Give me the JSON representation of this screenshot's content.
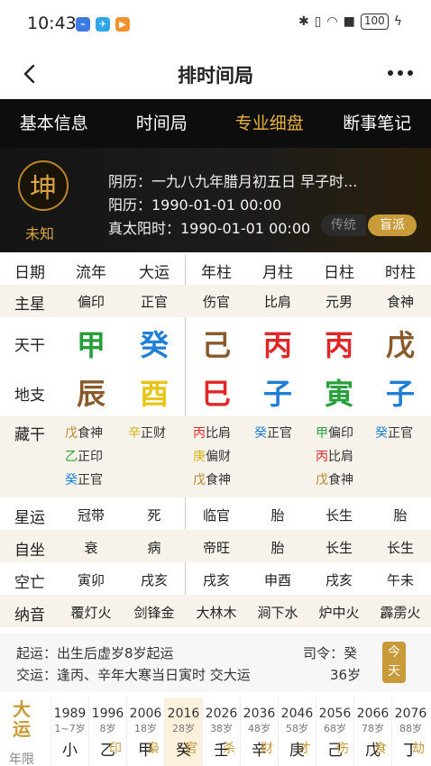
{
  "status": {
    "time": "10:43",
    "battery": "100"
  },
  "header": {
    "title": "排时间局"
  },
  "tabs": [
    {
      "label": "基本信息"
    },
    {
      "label": "时间局"
    },
    {
      "label": "专业细盘"
    },
    {
      "label": "断事笔记"
    }
  ],
  "profile": {
    "avatar_char": "坤",
    "gender_status": "未知",
    "lunar": "阴历：一九八九年腊月初五日 早子时...",
    "solar": "阳历：1990-01-01 00:00",
    "true_solar": "真太阳时：1990-01-01 00:00",
    "btn_traditional": "传统",
    "btn_blind": "盲派"
  },
  "columns": {
    "label": "日期",
    "headers": [
      "流年",
      "大运",
      "年柱",
      "月柱",
      "日柱",
      "时柱"
    ]
  },
  "rows": {
    "zhuxing": {
      "label": "主星",
      "values": [
        "偏印",
        "正官",
        "伤官",
        "比肩",
        "元男",
        "食神"
      ]
    },
    "tiangan": {
      "label": "天干",
      "values": [
        "甲",
        "癸",
        "己",
        "丙",
        "丙",
        "戊"
      ],
      "colors": [
        "#27a03c",
        "#1f7fd6",
        "#8b5a2b",
        "#e02626",
        "#e02626",
        "#8b5a2b"
      ]
    },
    "dizhi": {
      "label": "地支",
      "values": [
        "辰",
        "酉",
        "巳",
        "子",
        "寅",
        "子"
      ],
      "colors": [
        "#8b5a2b",
        "#e8c41a",
        "#e02626",
        "#1f7fd6",
        "#27a03c",
        "#1f7fd6"
      ]
    },
    "canggan": {
      "label": "藏干",
      "cols": [
        [
          {
            "g": "戊",
            "s": "食神",
            "c": "#b8862a"
          },
          {
            "g": "乙",
            "s": "正印",
            "c": "#27a03c"
          },
          {
            "g": "癸",
            "s": "正官",
            "c": "#1f7fd6"
          }
        ],
        [
          {
            "g": "辛",
            "s": "正财",
            "c": "#d6b21a"
          }
        ],
        [
          {
            "g": "丙",
            "s": "比肩",
            "c": "#e02626"
          },
          {
            "g": "庚",
            "s": "偏财",
            "c": "#d6b21a"
          },
          {
            "g": "戊",
            "s": "食神",
            "c": "#b8862a"
          }
        ],
        [
          {
            "g": "癸",
            "s": "正官",
            "c": "#1f7fd6"
          }
        ],
        [
          {
            "g": "甲",
            "s": "偏印",
            "c": "#27a03c"
          },
          {
            "g": "丙",
            "s": "比肩",
            "c": "#e02626"
          },
          {
            "g": "戊",
            "s": "食神",
            "c": "#b8862a"
          }
        ],
        [
          {
            "g": "癸",
            "s": "正官",
            "c": "#1f7fd6"
          }
        ]
      ]
    },
    "xingyun": {
      "label": "星运",
      "values": [
        "冠带",
        "死",
        "临官",
        "胎",
        "长生",
        "胎"
      ]
    },
    "zizuo": {
      "label": "自坐",
      "values": [
        "衰",
        "病",
        "帝旺",
        "胎",
        "长生",
        "长生"
      ]
    },
    "kongwang": {
      "label": "空亡",
      "values": [
        "寅卯",
        "戌亥",
        "戌亥",
        "申酉",
        "戌亥",
        "午未"
      ]
    },
    "nayin": {
      "label": "纳音",
      "values": [
        "覆灯火",
        "剑锋金",
        "大林木",
        "涧下水",
        "炉中火",
        "霹雳火"
      ]
    }
  },
  "luck": {
    "qiyun": "起运：出生后虚岁8岁起运",
    "siling": "司令：癸",
    "jiaoyun": "交运：逢丙、辛年大寒当日寅时 交大运",
    "age": "36岁",
    "today": "今天"
  },
  "dayun": {
    "label_top": "大",
    "label_bottom": "运",
    "year_label": "年限",
    "cols": [
      {
        "year": "1989",
        "age": "1~7岁",
        "gz": "小",
        "star": ""
      },
      {
        "year": "1996",
        "age": "8岁",
        "gz": "乙",
        "star": "印"
      },
      {
        "year": "2006",
        "age": "18岁",
        "gz": "甲",
        "star": "枭"
      },
      {
        "year": "2016",
        "age": "28岁",
        "gz": "癸",
        "star": "官"
      },
      {
        "year": "2026",
        "age": "38岁",
        "gz": "壬",
        "star": "杀"
      },
      {
        "year": "2036",
        "age": "48岁",
        "gz": "辛",
        "star": "财"
      },
      {
        "year": "2046",
        "age": "58岁",
        "gz": "庚",
        "star": "才"
      },
      {
        "year": "2056",
        "age": "68岁",
        "gz": "己",
        "star": "伤"
      },
      {
        "year": "2066",
        "age": "78岁",
        "gz": "戊",
        "star": "食"
      },
      {
        "year": "2076",
        "age": "88岁",
        "gz": "丁",
        "star": "劫"
      }
    ]
  }
}
